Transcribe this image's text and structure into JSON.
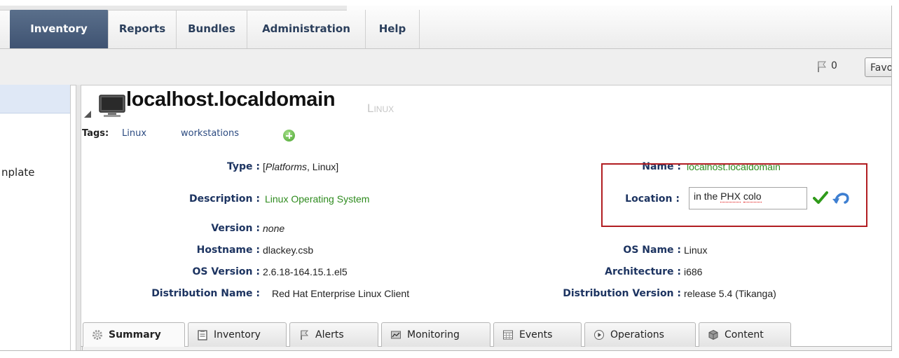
{
  "menu": {
    "items": [
      {
        "label": "Inventory",
        "active": true
      },
      {
        "label": "Reports",
        "active": false
      },
      {
        "label": "Bundles",
        "active": false
      },
      {
        "label": "Administration",
        "active": false
      },
      {
        "label": "Help",
        "active": false
      }
    ]
  },
  "toolbar": {
    "flag_count": "0",
    "favorites_label": "Favo"
  },
  "sidebar": {
    "partial_text": "nplate"
  },
  "resource": {
    "name": "localhost.localdomain",
    "type": "Linux",
    "tags_label": "Tags:",
    "tags": [
      "Linux",
      "workstations"
    ]
  },
  "details": {
    "type_label": "Type :",
    "type_value_prefix": "[",
    "type_value_italic": "Platforms",
    "type_value_suffix": ", Linux]",
    "description_label": "Description :",
    "description_value": "Linux Operating System",
    "version_label": "Version :",
    "version_value": "none",
    "hostname_label": "Hostname :",
    "hostname_value": "dlackey.csb",
    "os_version_label": "OS Version :",
    "os_version_value": "2.6.18-164.15.1.el5",
    "distribution_name_label": "Distribution Name :",
    "distribution_name_value": "Red Hat Enterprise Linux Client",
    "name_label": "Name :",
    "name_value": "localhost.localdomain",
    "location_label": "Location :",
    "location_value_pre": "in the ",
    "location_value_spell1": "PHX",
    "location_value_mid": " ",
    "location_value_spell2": "colo",
    "os_name_label": "OS Name :",
    "os_name_value": "Linux",
    "architecture_label": "Architecture :",
    "architecture_value": "i686",
    "distribution_version_label": "Distribution Version :",
    "distribution_version_value": "release 5.4 (Tikanga)"
  },
  "tabs": [
    {
      "label": "Summary",
      "icon": "gear-icon",
      "active": true
    },
    {
      "label": "Inventory",
      "icon": "clipboard-icon"
    },
    {
      "label": "Alerts",
      "icon": "flag-icon"
    },
    {
      "label": "Monitoring",
      "icon": "chart-icon"
    },
    {
      "label": "Events",
      "icon": "calendar-icon"
    },
    {
      "label": "Operations",
      "icon": "play-icon"
    },
    {
      "label": "Content",
      "icon": "cube-icon"
    }
  ],
  "colors": {
    "accent": "#3f5372",
    "link_green": "#2e8b1e",
    "label_blue": "#1d3461",
    "highlight_box": "#b11d22"
  }
}
